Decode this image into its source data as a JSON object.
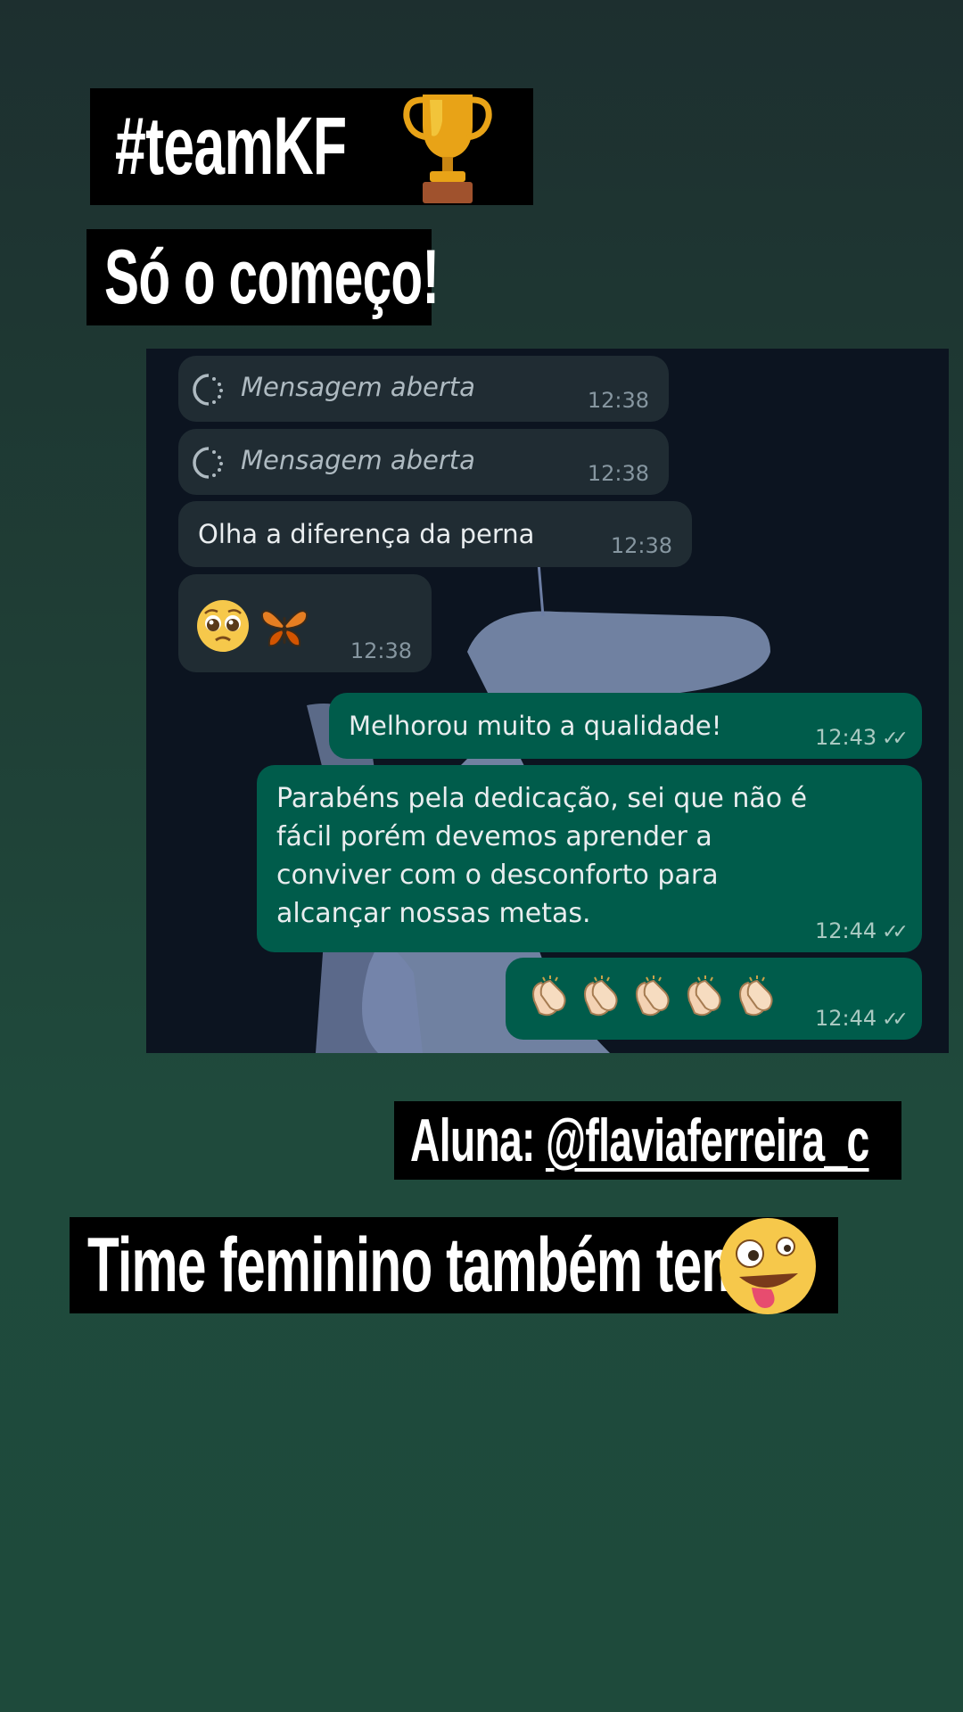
{
  "labels": {
    "team": "#teamKF",
    "start": "Só o começo!",
    "student_prefix": "Aluna: ",
    "student_handle": "@flaviaferreira_c",
    "women": "Time feminino também tem"
  },
  "icons": {
    "team": "trophy-icon",
    "women": "zany-face-icon",
    "opened": "view-once-opened-icon",
    "emoji_reply": [
      "pleading-face-icon",
      "butterfly-icon"
    ],
    "clap_reply": [
      "clapping-hands-icon",
      "clapping-hands-icon",
      "clapping-hands-icon",
      "clapping-hands-icon",
      "clapping-hands-icon"
    ],
    "read": "double-check-icon"
  },
  "chat": {
    "messages": [
      {
        "direction": "incoming",
        "text": "Mensagem aberta",
        "time": "12:38"
      },
      {
        "direction": "incoming",
        "text": "Mensagem aberta",
        "time": "12:38"
      },
      {
        "direction": "incoming",
        "text": "Olha a diferença da perna",
        "time": "12:38"
      },
      {
        "direction": "incoming",
        "text": "",
        "time": "12:38"
      },
      {
        "direction": "outgoing",
        "text": "Melhorou muito a qualidade!",
        "time": "12:43"
      },
      {
        "direction": "outgoing",
        "lines": [
          "Parabéns pela dedicação, sei que não é",
          "fácil porém devemos aprender a",
          "conviver com o desconforto para",
          "alcançar nossas metas."
        ],
        "time": "12:44"
      },
      {
        "direction": "outgoing",
        "text": "",
        "time": "12:44"
      }
    ]
  },
  "colors": {
    "incoming_bubble": "#202c33",
    "outgoing_bubble": "#005c4b",
    "chat_background": "#0c1420",
    "label_background": "#000000"
  }
}
